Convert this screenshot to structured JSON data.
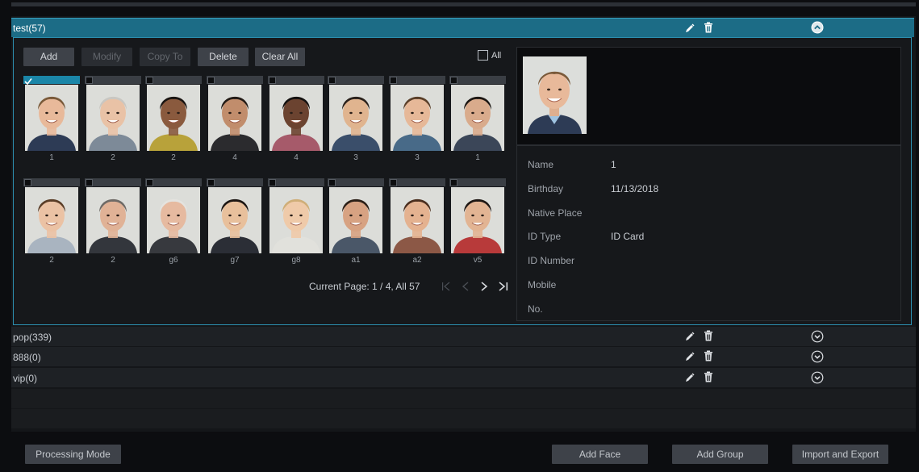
{
  "groups": [
    {
      "name": "test(57)",
      "expanded": true
    },
    {
      "name": "pop(339)",
      "expanded": false
    },
    {
      "name": "888(0)",
      "expanded": false
    },
    {
      "name": "vip(0)",
      "expanded": false
    }
  ],
  "toolbar": {
    "add": "Add",
    "modify": "Modify",
    "copy_to": "Copy To",
    "delete": "Delete",
    "clear_all": "Clear All",
    "all": "All"
  },
  "faces": [
    {
      "label": "1",
      "selected": true,
      "skin": "#e8b99a",
      "hair": "#7a5a3a",
      "shirt": "#2d3b55"
    },
    {
      "label": "2",
      "selected": false,
      "skin": "#e9c2a6",
      "hair": "#c9c7c2",
      "shirt": "#7d8a98"
    },
    {
      "label": "2",
      "selected": false,
      "skin": "#8a5a3e",
      "hair": "#1a1512",
      "shirt": "#b8a23a"
    },
    {
      "label": "4",
      "selected": false,
      "skin": "#c18d6c",
      "hair": "#231b16",
      "shirt": "#2b2b2e"
    },
    {
      "label": "4",
      "selected": false,
      "skin": "#6b4330",
      "hair": "#141110",
      "shirt": "#a65a6a"
    },
    {
      "label": "3",
      "selected": false,
      "skin": "#e0b48f",
      "hair": "#2a211b",
      "shirt": "#3a4e6a"
    },
    {
      "label": "3",
      "selected": false,
      "skin": "#e6b898",
      "hair": "#5a3f29",
      "shirt": "#486a88"
    },
    {
      "label": "1",
      "selected": false,
      "skin": "#d9ab8c",
      "hair": "#1d1713",
      "shirt": "#3b4658"
    },
    {
      "label": "2",
      "selected": false,
      "skin": "#ebc2a4",
      "hair": "#5a3d27",
      "shirt": "#a9b4c0"
    },
    {
      "label": "2",
      "selected": false,
      "skin": "#e0b296",
      "hair": "#6e6a66",
      "shirt": "#33363c"
    },
    {
      "label": "g6",
      "selected": false,
      "skin": "#e6baa0",
      "hair": "#e4e3df",
      "shirt": "#37393e"
    },
    {
      "label": "g7",
      "selected": false,
      "skin": "#e8c09c",
      "hair": "#1c1613",
      "shirt": "#2b2e36"
    },
    {
      "label": "g8",
      "selected": false,
      "skin": "#efcaa9",
      "hair": "#cfae78",
      "shirt": "#e1e1dc"
    },
    {
      "label": "a1",
      "selected": false,
      "skin": "#d7a282",
      "hair": "#2b1f17",
      "shirt": "#4a5768"
    },
    {
      "label": "a2",
      "selected": false,
      "skin": "#e4b290",
      "hair": "#4a2e1e",
      "shirt": "#8c5846"
    },
    {
      "label": "v5",
      "selected": false,
      "skin": "#e2b493",
      "hair": "#1e1714",
      "shirt": "#b83a3a"
    }
  ],
  "pager": {
    "text": "Current Page: 1 / 4, All 57",
    "first_icon": "first-page-icon",
    "prev_icon": "prev-page-icon",
    "next_icon": "next-page-icon",
    "last_icon": "last-page-icon"
  },
  "detail": {
    "fields": [
      {
        "label": "Name",
        "value": "1"
      },
      {
        "label": "Birthday",
        "value": "11/13/2018"
      },
      {
        "label": "Native Place",
        "value": ""
      },
      {
        "label": "ID Type",
        "value": "ID Card"
      },
      {
        "label": "ID Number",
        "value": ""
      },
      {
        "label": "Mobile",
        "value": ""
      },
      {
        "label": "No.",
        "value": ""
      }
    ]
  },
  "footer": {
    "processing_mode": "Processing Mode",
    "add_face": "Add Face",
    "add_group": "Add Group",
    "import_export": "Import and Export"
  },
  "colors": {
    "accent": "#1c6c86",
    "accent_border": "#2c8fb0",
    "button_bg": "#3e4249"
  }
}
